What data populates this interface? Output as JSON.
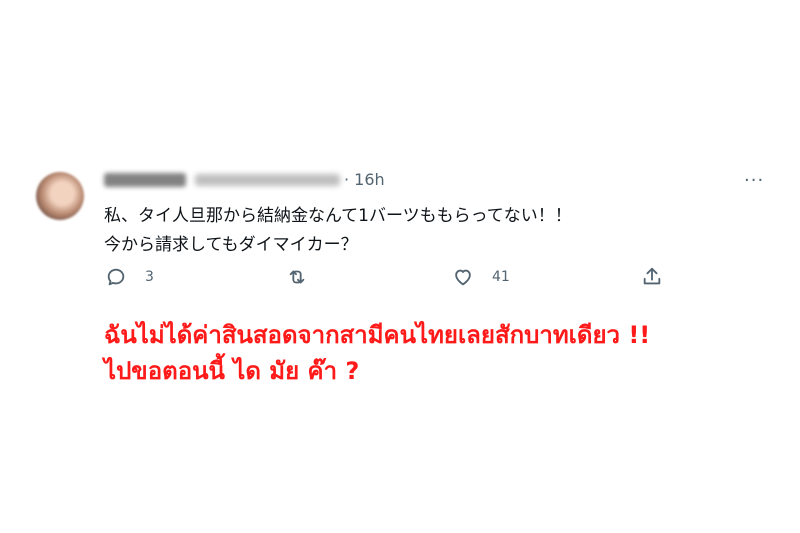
{
  "tweet": {
    "time": "16h",
    "more": "···",
    "text_line1": "私、タイ人旦那から結納金なんて1バーツももらってない！！",
    "text_line2": "今から請求してもダイマイカー？",
    "actions": {
      "reply_count": "3",
      "like_count": "41"
    }
  },
  "overlay": {
    "line1": "ฉันไม่ได้ค่าสินสอดจากสามีคนไทยเลยสักบาทเดียว !!",
    "line2": "ไปขอตอนนี้ ได มัย ค๊า ?"
  },
  "colors": {
    "muted": "#536471",
    "overlay_text": "#ff1a1a"
  },
  "icons": [
    "reply-icon",
    "retweet-icon",
    "like-icon",
    "share-icon",
    "more-icon"
  ]
}
